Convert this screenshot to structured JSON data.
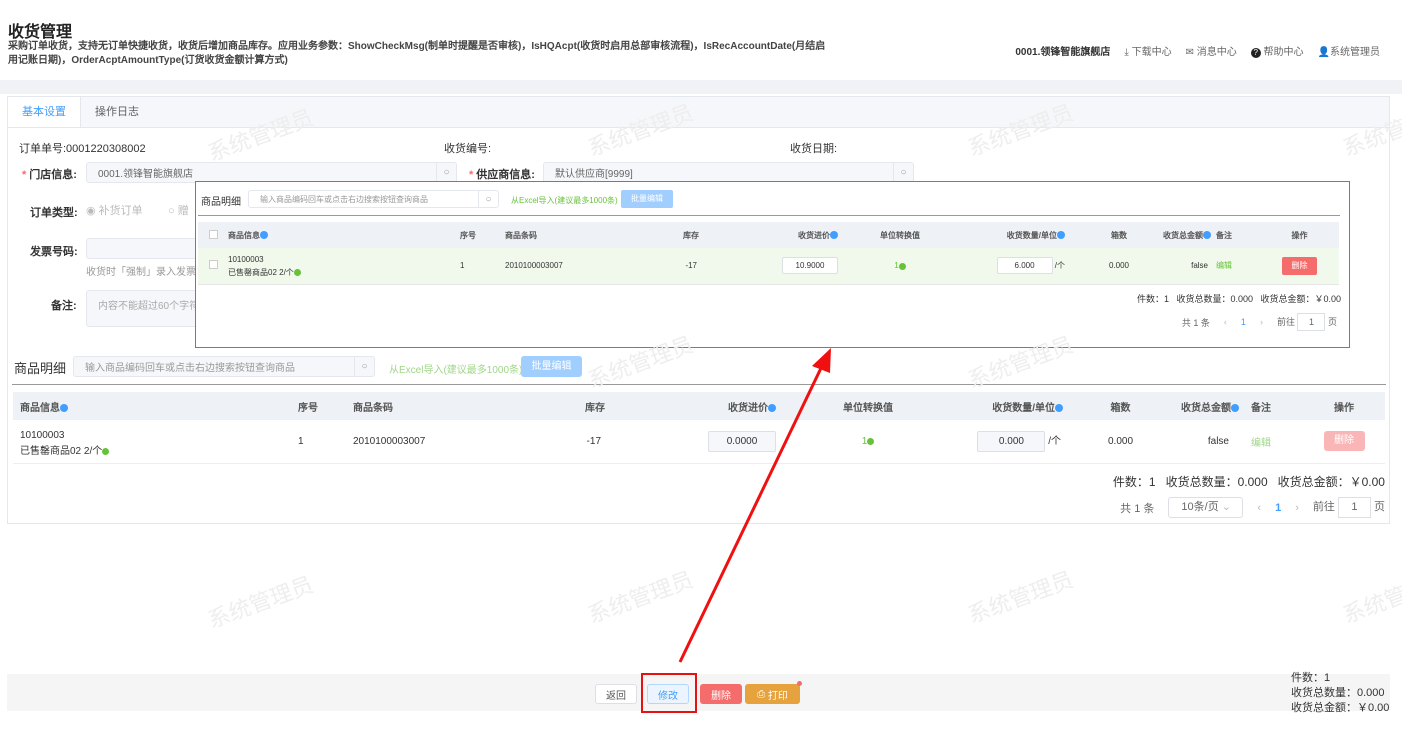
{
  "header": {
    "title": "收货管理",
    "description": "采购订单收货，支持无订单快捷收货，收货后增加商品库存。应用业务参数：ShowCheckMsg(制单时提醒是否审核)，IsHQAcpt(收货时启用总部审核流程)，IsRecAccountDate(月结启用记账日期)，OrderAcptAmountType(订货收货金额计算方式)"
  },
  "topnav": {
    "store": "0001.领锋智能旗舰店",
    "download": "下载中心",
    "messages": "消息中心",
    "help": "帮助中心",
    "user": "系统管理员"
  },
  "watermark": "系统管理员",
  "tabs": [
    {
      "label": "基本设置"
    },
    {
      "label": "操作日志"
    }
  ],
  "form": {
    "order_no": "订单单号:0001220308002",
    "receipt_no_label": "收货编号:",
    "receipt_date_label": "收货日期:",
    "store_label": "门店信息:",
    "store_value": "0001.领锋智能旗舰店",
    "supplier_label": "供应商信息:",
    "supplier_value": "默认供应商[9999]",
    "order_type_label": "订单类型:",
    "order_type_option1": "补货订单",
    "order_type_option2": "赠",
    "invoice_label": "发票号码:",
    "invoice_hint": "收货时「强制」录入发票。",
    "remark_label": "备注:",
    "remark_placeholder": "内容不能超过60个字符"
  },
  "detail": {
    "title": "商品明细",
    "search_placeholder": "输入商品编码回车或点击右边搜索按钮查询商品",
    "excel_import": "从Excel导入(建议最多1000条)",
    "batch_edit": "批量编辑",
    "columns": [
      "商品信息",
      "序号",
      "商品条码",
      "库存",
      "收货进价",
      "单位转换值",
      "收货数量/单位",
      "箱数",
      "收货总金额",
      "备注",
      "操作"
    ],
    "row": {
      "code": "10100003",
      "name": "已售罄商品02 2/个",
      "seq": "1",
      "barcode": "2010100003007",
      "stock": "-17",
      "price": "0.0000",
      "unit_conv": "1",
      "qty": "0.000",
      "unit": "/个",
      "boxes": "0.000",
      "total": "false",
      "remark_action": "编辑",
      "delete": "删除"
    },
    "summary": "件数：1   收货总数量：0.000   收货总金额：￥0.00",
    "pager": {
      "total": "共 1 条",
      "page_size": "10条/页",
      "current": "1",
      "goto": "前往",
      "goto_value": "1",
      "page_suffix": "页"
    }
  },
  "popup": {
    "row": {
      "price": "10.9000",
      "qty": "6.000"
    },
    "summary": "件数：1   收货总数量：0.000   收货总金额：￥0.00"
  },
  "footer": {
    "back": "返回",
    "edit": "修改",
    "delete": "删除",
    "print": "打印",
    "count": "件数：1",
    "total_qty": "收货总数量：0.000",
    "total_amount": "收货总金额：￥0.00"
  }
}
